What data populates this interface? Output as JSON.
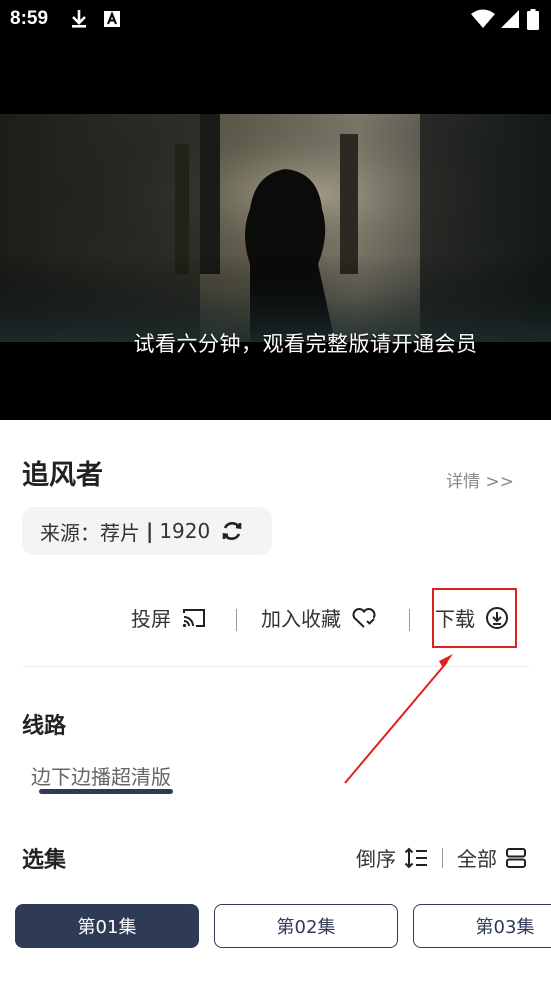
{
  "status_bar": {
    "time": "8:59",
    "left_icons": [
      "download-icon",
      "a-notification-icon"
    ],
    "right_icons": [
      "wifi-icon",
      "signal-icon",
      "battery-icon"
    ]
  },
  "player": {
    "caption": "试看六分钟，观看完整版请开通会员"
  },
  "video": {
    "title": "追风者",
    "detail_link": "详情 >>",
    "source_label": "来源：荐片",
    "source_separator": "|",
    "source_value": "1920"
  },
  "actions": {
    "cast": "投屏",
    "favorite": "加入收藏",
    "download": "下载"
  },
  "route": {
    "title": "线路",
    "items": [
      "边下边播超清版"
    ]
  },
  "episodes": {
    "title": "选集",
    "sort_label": "倒序",
    "all_label": "全部",
    "items": [
      "第01集",
      "第02集",
      "第03集"
    ]
  },
  "colors": {
    "accent": "#2f3a55",
    "annotation": "#e0201d"
  }
}
